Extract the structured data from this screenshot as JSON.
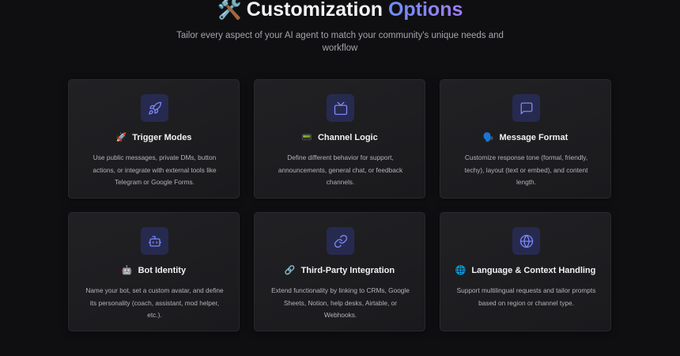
{
  "section": {
    "heading_emoji": "🛠️",
    "heading_word1": "Customization",
    "heading_word2": "Options",
    "subtitle": "Tailor every aspect of your AI agent to match your community's unique needs and workflow"
  },
  "cards": [
    {
      "icon": "rocket-icon",
      "emoji": "🚀",
      "title": "Trigger Modes",
      "description": "Use public messages, private DMs, button actions, or integrate with external tools like Telegram or Google Forms."
    },
    {
      "icon": "tv-icon",
      "emoji": "📟",
      "title": "Channel Logic",
      "description": "Define different behavior for support, announcements, general chat, or feedback channels."
    },
    {
      "icon": "message-square-icon",
      "emoji": "🗣️",
      "title": "Message Format",
      "description": "Customize response tone (formal, friendly, techy), layout (text or embed), and content length."
    },
    {
      "icon": "bot-icon",
      "emoji": "🤖",
      "title": "Bot Identity",
      "description": "Name your bot, set a custom avatar, and define its personality (coach, assistant, mod helper, etc.)."
    },
    {
      "icon": "link-icon",
      "emoji": "🔗",
      "title": "Third-Party Integration",
      "description": "Extend functionality by linking to CRMs, Google Sheets, Notion, help desks, Airtable, or Webhooks."
    },
    {
      "icon": "globe-icon",
      "emoji": "🌐",
      "title": "Language & Context Handling",
      "description": "Support multilingual requests and tailor prompts based on region or channel type."
    }
  ],
  "colors": {
    "background": "#0f0f11",
    "card": "#1e1e21",
    "icon_box": "#272a4f",
    "icon_stroke": "#7a86f8",
    "accent_gradient_start": "#6e8cf7",
    "accent_gradient_end": "#a07cf4"
  }
}
